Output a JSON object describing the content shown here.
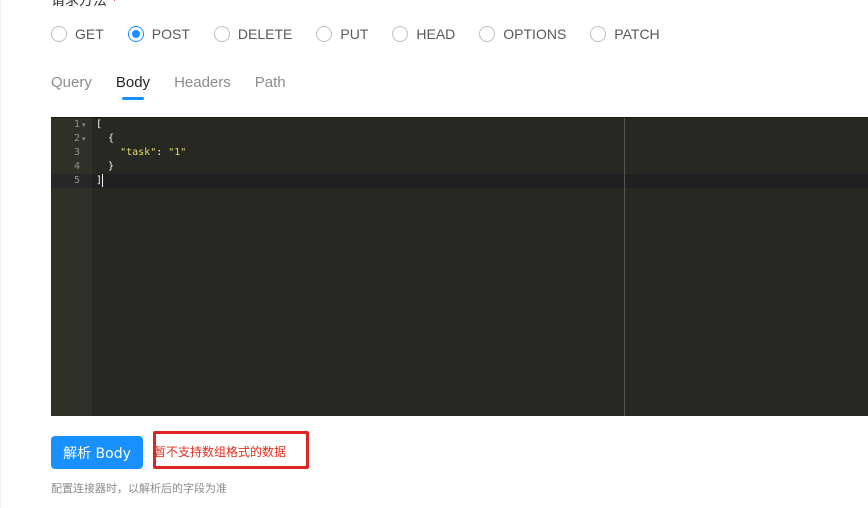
{
  "form": {
    "method_label": "请求方法",
    "required_mark": "*",
    "methods": [
      {
        "label": "GET",
        "checked": false
      },
      {
        "label": "POST",
        "checked": true
      },
      {
        "label": "DELETE",
        "checked": false
      },
      {
        "label": "PUT",
        "checked": false
      },
      {
        "label": "HEAD",
        "checked": false
      },
      {
        "label": "OPTIONS",
        "checked": false
      },
      {
        "label": "PATCH",
        "checked": false
      }
    ]
  },
  "tabs": [
    {
      "label": "Query",
      "active": false
    },
    {
      "label": "Body",
      "active": true
    },
    {
      "label": "Headers",
      "active": false
    },
    {
      "label": "Path",
      "active": false
    }
  ],
  "editor": {
    "line_numbers": [
      "1",
      "2",
      "3",
      "4",
      "5"
    ],
    "fold_markers": [
      "▾",
      "▾"
    ],
    "lines": {
      "l1": "[",
      "l2": "  {",
      "l3_indent": "    ",
      "l3_key": "\"task\"",
      "l3_sep": ": ",
      "l3_value": "\"1\"",
      "l4": "  }",
      "l5": "]"
    }
  },
  "actions": {
    "parse_button": "解析 Body"
  },
  "error": {
    "message": "暂不支持数组格式的数据"
  },
  "help": {
    "text": "配置连接器时，以解析后的字段为准"
  }
}
